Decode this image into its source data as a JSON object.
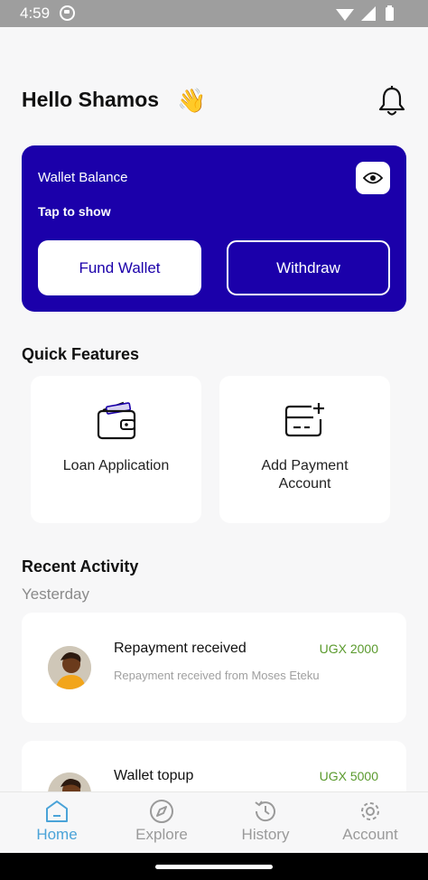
{
  "status_bar": {
    "time": "4:59"
  },
  "header": {
    "greeting": "Hello Shamos",
    "wave_emoji": "👋"
  },
  "wallet": {
    "label": "Wallet Balance",
    "tap_to_show": "Tap to show",
    "fund_label": "Fund Wallet",
    "withdraw_label": "Withdraw",
    "card_color": "#1b00aa"
  },
  "quick_features": {
    "title": "Quick Features",
    "items": [
      {
        "label": "Loan Application",
        "icon": "wallet-icon"
      },
      {
        "label": "Add Payment Account",
        "icon": "add-card-icon"
      }
    ]
  },
  "recent_activity": {
    "title": "Recent Activity",
    "group_label": "Yesterday",
    "items": [
      {
        "title": "Repayment received",
        "amount": "UGX 2000",
        "description": "Repayment received from Moses Eteku"
      },
      {
        "title": "Wallet topup",
        "amount": "UGX 5000",
        "description": ""
      }
    ]
  },
  "bottom_nav": {
    "items": [
      {
        "label": "Home",
        "icon": "home-icon",
        "active": true
      },
      {
        "label": "Explore",
        "icon": "compass-icon",
        "active": false
      },
      {
        "label": "History",
        "icon": "history-icon",
        "active": false
      },
      {
        "label": "Account",
        "icon": "gear-icon",
        "active": false
      }
    ]
  },
  "colors": {
    "accent": "#1b00aa",
    "nav_active": "#4aa3d8",
    "amount": "#5a9a2d"
  }
}
